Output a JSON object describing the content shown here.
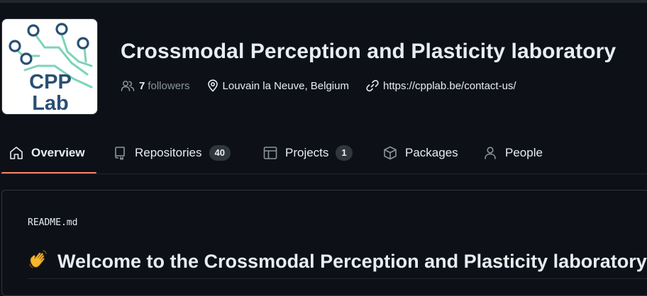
{
  "org": {
    "logo_text_line1": "CPP",
    "logo_text_line2": "Lab",
    "name": "Crossmodal Perception and Plasticity laboratory",
    "followers_count": "7",
    "followers_label": "followers",
    "location": "Louvain la Neuve, Belgium",
    "website": "https://cpplab.be/contact-us/"
  },
  "tabs": [
    {
      "label": "Overview",
      "icon": "home-icon",
      "selected": true
    },
    {
      "label": "Repositories",
      "icon": "repo-icon",
      "count": "40"
    },
    {
      "label": "Projects",
      "icon": "table-icon",
      "count": "1"
    },
    {
      "label": "Packages",
      "icon": "package-icon"
    },
    {
      "label": "People",
      "icon": "person-icon"
    }
  ],
  "readme": {
    "filename": "README.md",
    "heading_emoji": "waving-hand-icon",
    "heading": "Welcome to the Crossmodal Perception and Plasticity laboratory"
  },
  "colors": {
    "background": "#0d1117",
    "text": "#e6edf3",
    "muted": "#8b949e",
    "border": "#30363d",
    "tab_underline": "#f78166",
    "logo_text": "#2a4f73",
    "logo_circuit": "#7dd3b8"
  }
}
